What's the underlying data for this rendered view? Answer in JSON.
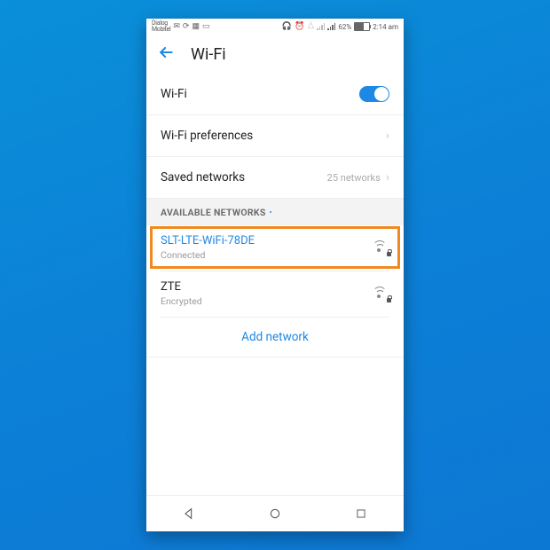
{
  "status": {
    "carrier": "Dialog\nMobitel",
    "battery_pct": "62%",
    "time": "2:14 am"
  },
  "header": {
    "title": "Wi-Fi"
  },
  "rows": {
    "wifi_toggle_label": "Wi-Fi",
    "prefs_label": "Wi-Fi preferences",
    "saved_label": "Saved networks",
    "saved_value": "25 networks"
  },
  "section_label": "AVAILABLE NETWORKS",
  "networks": [
    {
      "ssid": "SLT-LTE-WiFi-78DE",
      "sub": "Connected"
    },
    {
      "ssid": "ZTE",
      "sub": "Encrypted"
    }
  ],
  "add_label": "Add network"
}
